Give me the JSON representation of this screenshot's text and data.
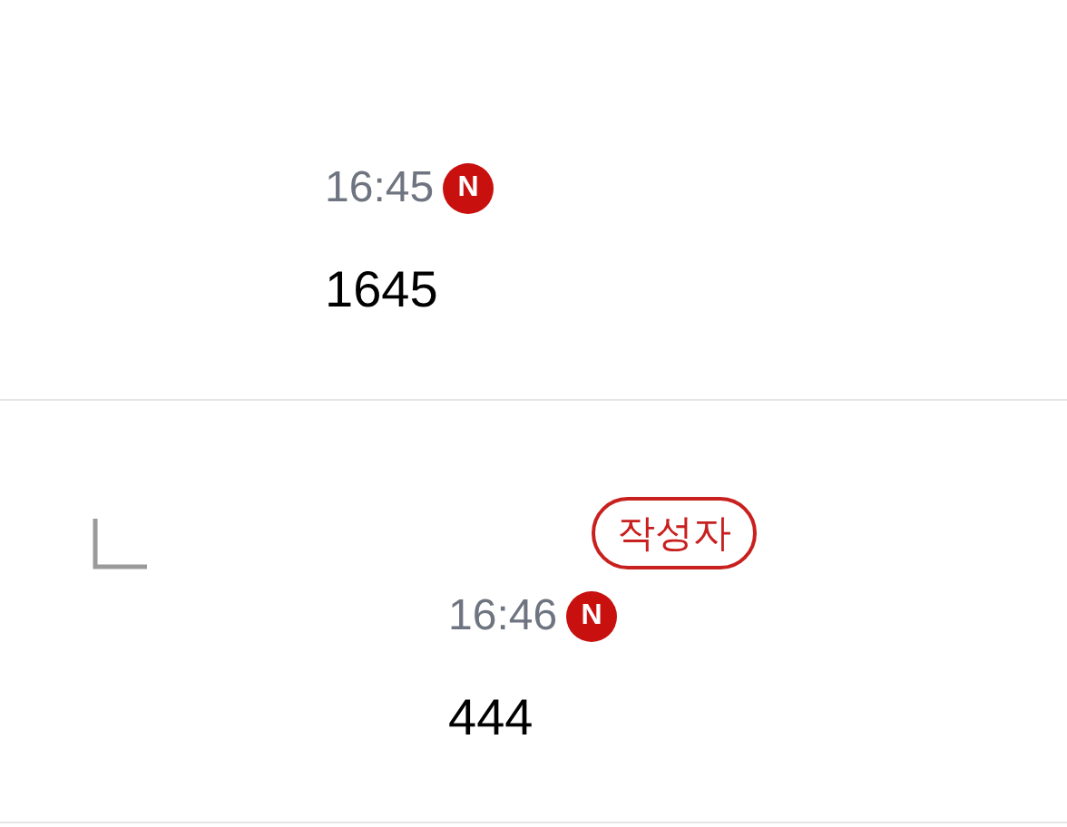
{
  "comments": [
    {
      "kind": "comment",
      "time": "16:45",
      "new_badge": "N",
      "text": "1645"
    },
    {
      "kind": "reply",
      "author_badge": "작성자",
      "time": "16:46",
      "new_badge": "N",
      "text": "444"
    }
  ]
}
